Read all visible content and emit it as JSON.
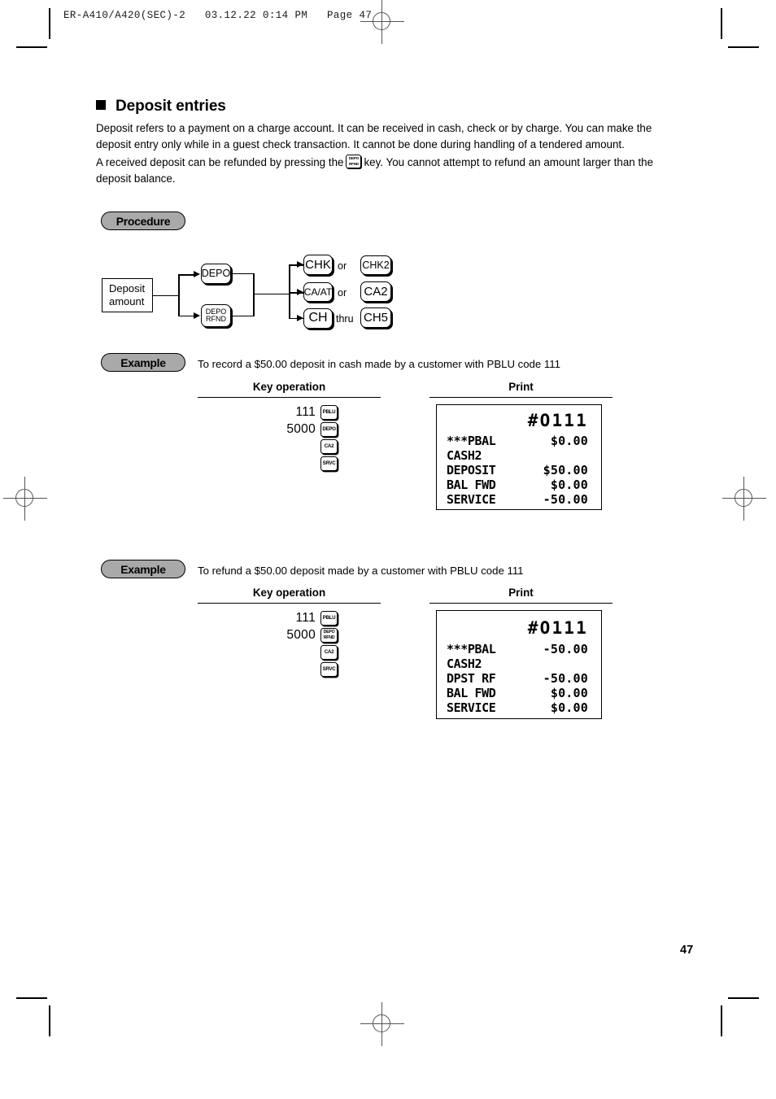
{
  "running_head": "ER-A410/A420(SEC)-2   03.12.22 0:14 PM   Page 47",
  "section": {
    "title": "Deposit entries",
    "paragraph_1": "Deposit refers to a payment on a charge account. It can be received in cash, check or by charge. You can make the deposit entry only while in a guest check transaction. It cannot be done during handling of a tendered amount.",
    "paragraph_2_before": "A received deposit can be refunded by pressing the",
    "inline_key": {
      "line1": "DEPO",
      "line2": "RFND"
    },
    "paragraph_2_after": "key. You cannot attempt to refund an amount larger than the deposit balance."
  },
  "badges": {
    "procedure": "Procedure",
    "example": "Example"
  },
  "flow": {
    "start_box": {
      "line1": "Deposit",
      "line2": "amount"
    },
    "middle_keys": [
      {
        "line1": "DEPO",
        "line2": ""
      },
      {
        "line1": "DEPO",
        "line2": "RFND"
      }
    ],
    "branches": [
      {
        "key": "CHK",
        "word": "or",
        "alt": "CHK2"
      },
      {
        "key": "CA/AT",
        "word": "or",
        "alt": "CA2"
      },
      {
        "key": "CH",
        "word": "thru",
        "alt": "CH5"
      }
    ]
  },
  "columns": {
    "key_operation": "Key operation",
    "print": "Print"
  },
  "examples": [
    {
      "caption": "To record a $50.00 deposit in cash made by a customer with PBLU code 111",
      "keys": [
        {
          "number": "111",
          "key_line1": "PBLU",
          "key_line2": ""
        },
        {
          "number": "5000",
          "key_line1": "DEPO",
          "key_line2": ""
        },
        {
          "number": "",
          "key_line1": "CA2",
          "key_line2": ""
        },
        {
          "number": "",
          "key_line1": "SRVC",
          "key_line2": ""
        }
      ],
      "receipt": {
        "header": "#O111",
        "lines": [
          {
            "label": "***PBAL",
            "amount": "$0.00"
          },
          {
            "label": "CASH2",
            "amount": ""
          },
          {
            "label": "DEPOSIT",
            "amount": "$50.00"
          },
          {
            "label": "BAL FWD",
            "amount": "$0.00"
          },
          {
            "label": "SERVICE",
            "amount": "-50.00"
          }
        ]
      }
    },
    {
      "caption": "To refund a $50.00 deposit made by a customer with PBLU code 111",
      "keys": [
        {
          "number": "111",
          "key_line1": "PBLU",
          "key_line2": ""
        },
        {
          "number": "5000",
          "key_line1": "DEPO",
          "key_line2": "RFND"
        },
        {
          "number": "",
          "key_line1": "CA2",
          "key_line2": ""
        },
        {
          "number": "",
          "key_line1": "SRVC",
          "key_line2": ""
        }
      ],
      "receipt": {
        "header": "#O111",
        "lines": [
          {
            "label": "***PBAL",
            "amount": "-50.00"
          },
          {
            "label": "CASH2",
            "amount": ""
          },
          {
            "label": "DPST RF",
            "amount": "-50.00"
          },
          {
            "label": "BAL FWD",
            "amount": "$0.00"
          },
          {
            "label": "SERVICE",
            "amount": "$0.00"
          }
        ]
      }
    }
  ],
  "page_number": "47"
}
